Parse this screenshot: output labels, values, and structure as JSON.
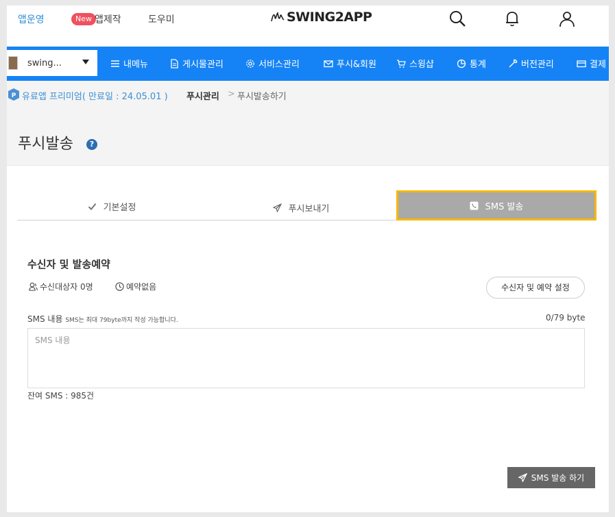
{
  "header": {
    "links": {
      "operate": "앱운영",
      "new_badge": "New",
      "build": "앱제작",
      "help": "도우미"
    },
    "logo_text": "SWING2APP",
    "icons": [
      "search-icon",
      "bell-icon",
      "user-icon"
    ]
  },
  "nav": {
    "app_select": "swing...",
    "items": [
      {
        "label": "내메뉴",
        "icon": "menu-icon"
      },
      {
        "label": "게시물관리",
        "icon": "document-icon"
      },
      {
        "label": "서비스관리",
        "icon": "gear-icon"
      },
      {
        "label": "푸시&회원",
        "icon": "mail-icon"
      },
      {
        "label": "스윙샵",
        "icon": "cart-icon"
      },
      {
        "label": "통계",
        "icon": "pie-chart-icon"
      },
      {
        "label": "버전관리",
        "icon": "wrench-icon"
      },
      {
        "label": "결제",
        "icon": "card-icon"
      }
    ],
    "accent": "#1583f5"
  },
  "breadcrumb": {
    "plan_badge": "P",
    "plan": "유료앱 프리미엄( 만료일 : 24.05.01 )",
    "parent": "푸시관리",
    "separator": ">",
    "current": "푸시발송하기"
  },
  "page": {
    "title": "푸시발송",
    "help": "?"
  },
  "tabs": [
    {
      "label": "기본설정",
      "icon": "check-icon",
      "active": false
    },
    {
      "label": "푸시보내기",
      "icon": "paper-plane-icon",
      "active": false
    },
    {
      "label": "SMS 발송",
      "icon": "phone-icon",
      "active": true
    }
  ],
  "section": {
    "title": "수신자 및 발송예약",
    "recipients": "수신대상자 0명",
    "reservation": "예약없음",
    "setting_button": "수신자 및 예약 설정"
  },
  "sms": {
    "label": "SMS 내용",
    "note": "SMS는 최대 79byte까지 작성 가능합니다.",
    "byte_count": "0/79 byte",
    "placeholder": "SMS 내용",
    "value": "",
    "remaining": "잔여 SMS : 985건",
    "send_button": "SMS 발송 하기"
  }
}
